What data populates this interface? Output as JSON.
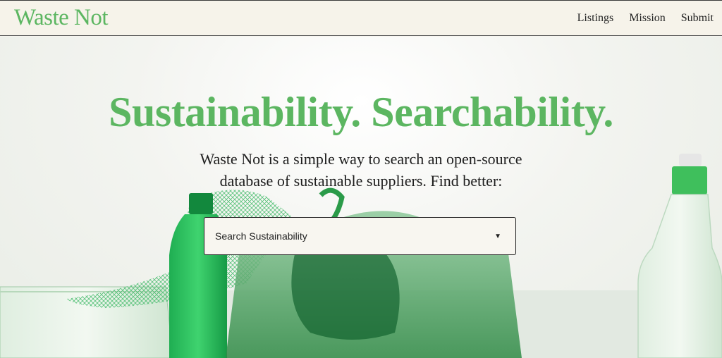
{
  "brand": {
    "name": "Waste Not",
    "color": "#5cb661"
  },
  "nav": {
    "items": [
      "Listings",
      "Mission",
      "Submit"
    ]
  },
  "hero": {
    "headline": "Sustainability. Searchability.",
    "subtext": "Waste Not is a simple way to search an open-source database of sustainable suppliers. Find better:",
    "search": {
      "placeholder": "Search Sustainability",
      "icon": "caret-down-icon"
    },
    "background": "photo-of-green-plastic-waste"
  }
}
